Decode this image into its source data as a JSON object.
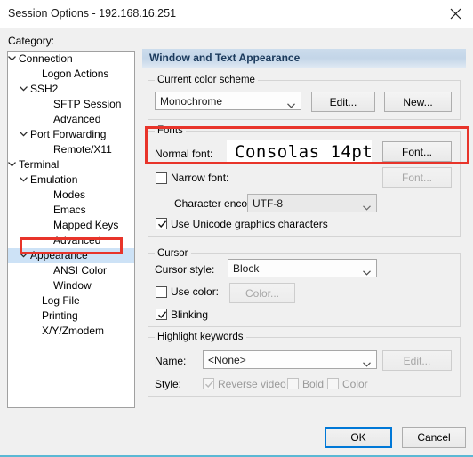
{
  "window": {
    "title": "Session Options - 192.168.16.251",
    "close_icon": "close-icon"
  },
  "category": {
    "label": "Category:",
    "tree": [
      {
        "label": "Connection",
        "depth": 0,
        "chevron": "chevron-down-icon",
        "selected": false
      },
      {
        "label": "Logon Actions",
        "depth": 2,
        "chevron": "",
        "selected": false
      },
      {
        "label": "SSH2",
        "depth": 1,
        "chevron": "chevron-down-icon",
        "selected": false
      },
      {
        "label": "SFTP Session",
        "depth": 3,
        "chevron": "",
        "selected": false
      },
      {
        "label": "Advanced",
        "depth": 3,
        "chevron": "",
        "selected": false
      },
      {
        "label": "Port Forwarding",
        "depth": 1,
        "chevron": "chevron-down-icon",
        "selected": false
      },
      {
        "label": "Remote/X11",
        "depth": 3,
        "chevron": "",
        "selected": false
      },
      {
        "label": "Terminal",
        "depth": 0,
        "chevron": "chevron-down-icon",
        "selected": false
      },
      {
        "label": "Emulation",
        "depth": 1,
        "chevron": "chevron-down-icon",
        "selected": false
      },
      {
        "label": "Modes",
        "depth": 3,
        "chevron": "",
        "selected": false
      },
      {
        "label": "Emacs",
        "depth": 3,
        "chevron": "",
        "selected": false
      },
      {
        "label": "Mapped Keys",
        "depth": 3,
        "chevron": "",
        "selected": false
      },
      {
        "label": "Advanced",
        "depth": 3,
        "chevron": "",
        "selected": false
      },
      {
        "label": "Appearance",
        "depth": 1,
        "chevron": "chevron-down-icon",
        "selected": true
      },
      {
        "label": "ANSI Color",
        "depth": 3,
        "chevron": "",
        "selected": false
      },
      {
        "label": "Window",
        "depth": 3,
        "chevron": "",
        "selected": false
      },
      {
        "label": "Log File",
        "depth": 2,
        "chevron": "",
        "selected": false
      },
      {
        "label": "Printing",
        "depth": 2,
        "chevron": "",
        "selected": false
      },
      {
        "label": "X/Y/Zmodem",
        "depth": 2,
        "chevron": "",
        "selected": false
      }
    ]
  },
  "panel": {
    "header": "Window and Text Appearance",
    "color_scheme": {
      "group_title": "Current color scheme",
      "selected": "Monochrome",
      "edit_label": "Edit...",
      "new_label": "New..."
    },
    "fonts": {
      "group_title": "Fonts",
      "normal_font_label": "Normal font:",
      "normal_font_value": "Consolas 14pt",
      "normal_font_button": "Font...",
      "narrow_font_label": "Narrow font:",
      "narrow_font_checked": false,
      "narrow_font_button": "Font...",
      "encoding_label": "Character encoding:",
      "encoding_value": "UTF-8",
      "unicode_label": "Use Unicode graphics characters",
      "unicode_checked": true
    },
    "cursor": {
      "group_title": "Cursor",
      "style_label": "Cursor style:",
      "style_value": "Block",
      "use_color_label": "Use color:",
      "use_color_checked": false,
      "color_button": "Color...",
      "blinking_label": "Blinking",
      "blinking_checked": true
    },
    "highlight": {
      "group_title": "Highlight keywords",
      "name_label": "Name:",
      "name_value": "<None>",
      "edit_button": "Edit...",
      "style_label": "Style:",
      "reverse_video_label": "Reverse video",
      "reverse_video_checked": true,
      "bold_label": "Bold",
      "bold_checked": false,
      "color_label": "Color",
      "color_checked": false
    }
  },
  "footer": {
    "ok_label": "OK",
    "cancel_label": "Cancel"
  },
  "colors": {
    "accent": "#0078d7",
    "annotation": "#e8342a",
    "selection": "#cde2f6",
    "header_blue": "#c3d5e8"
  }
}
